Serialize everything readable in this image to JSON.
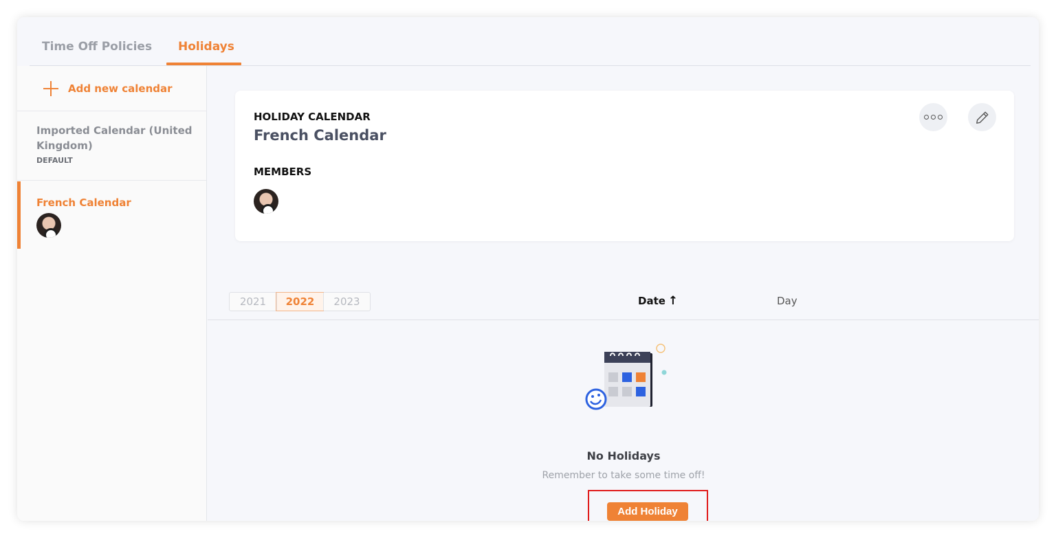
{
  "tabs": [
    {
      "label": "Time Off Policies",
      "active": false
    },
    {
      "label": "Holidays",
      "active": true
    }
  ],
  "sidebar": {
    "add_label": "Add new calendar",
    "calendars": [
      {
        "name": "Imported Calendar (United Kingdom)",
        "badge": "DEFAULT",
        "selected": false
      },
      {
        "name": "French Calendar",
        "badge": "",
        "selected": true
      }
    ]
  },
  "card": {
    "label": "HOLIDAY CALENDAR",
    "title": "French Calendar",
    "members_label": "MEMBERS",
    "more_icon": "more-options-icon",
    "edit_icon": "pencil-icon"
  },
  "years": {
    "items": [
      "2021",
      "2022",
      "2023"
    ],
    "selected": "2022"
  },
  "table": {
    "columns": [
      "Date",
      "Day"
    ],
    "sort_icon": "arrow-up-icon"
  },
  "empty": {
    "title": "No Holidays",
    "subtitle": "Remember to take some time off!",
    "button_label": "Add Holiday"
  },
  "colors": {
    "accent": "#ef8235",
    "highlight": "#e01b1b",
    "background": "#f6f7fb"
  }
}
